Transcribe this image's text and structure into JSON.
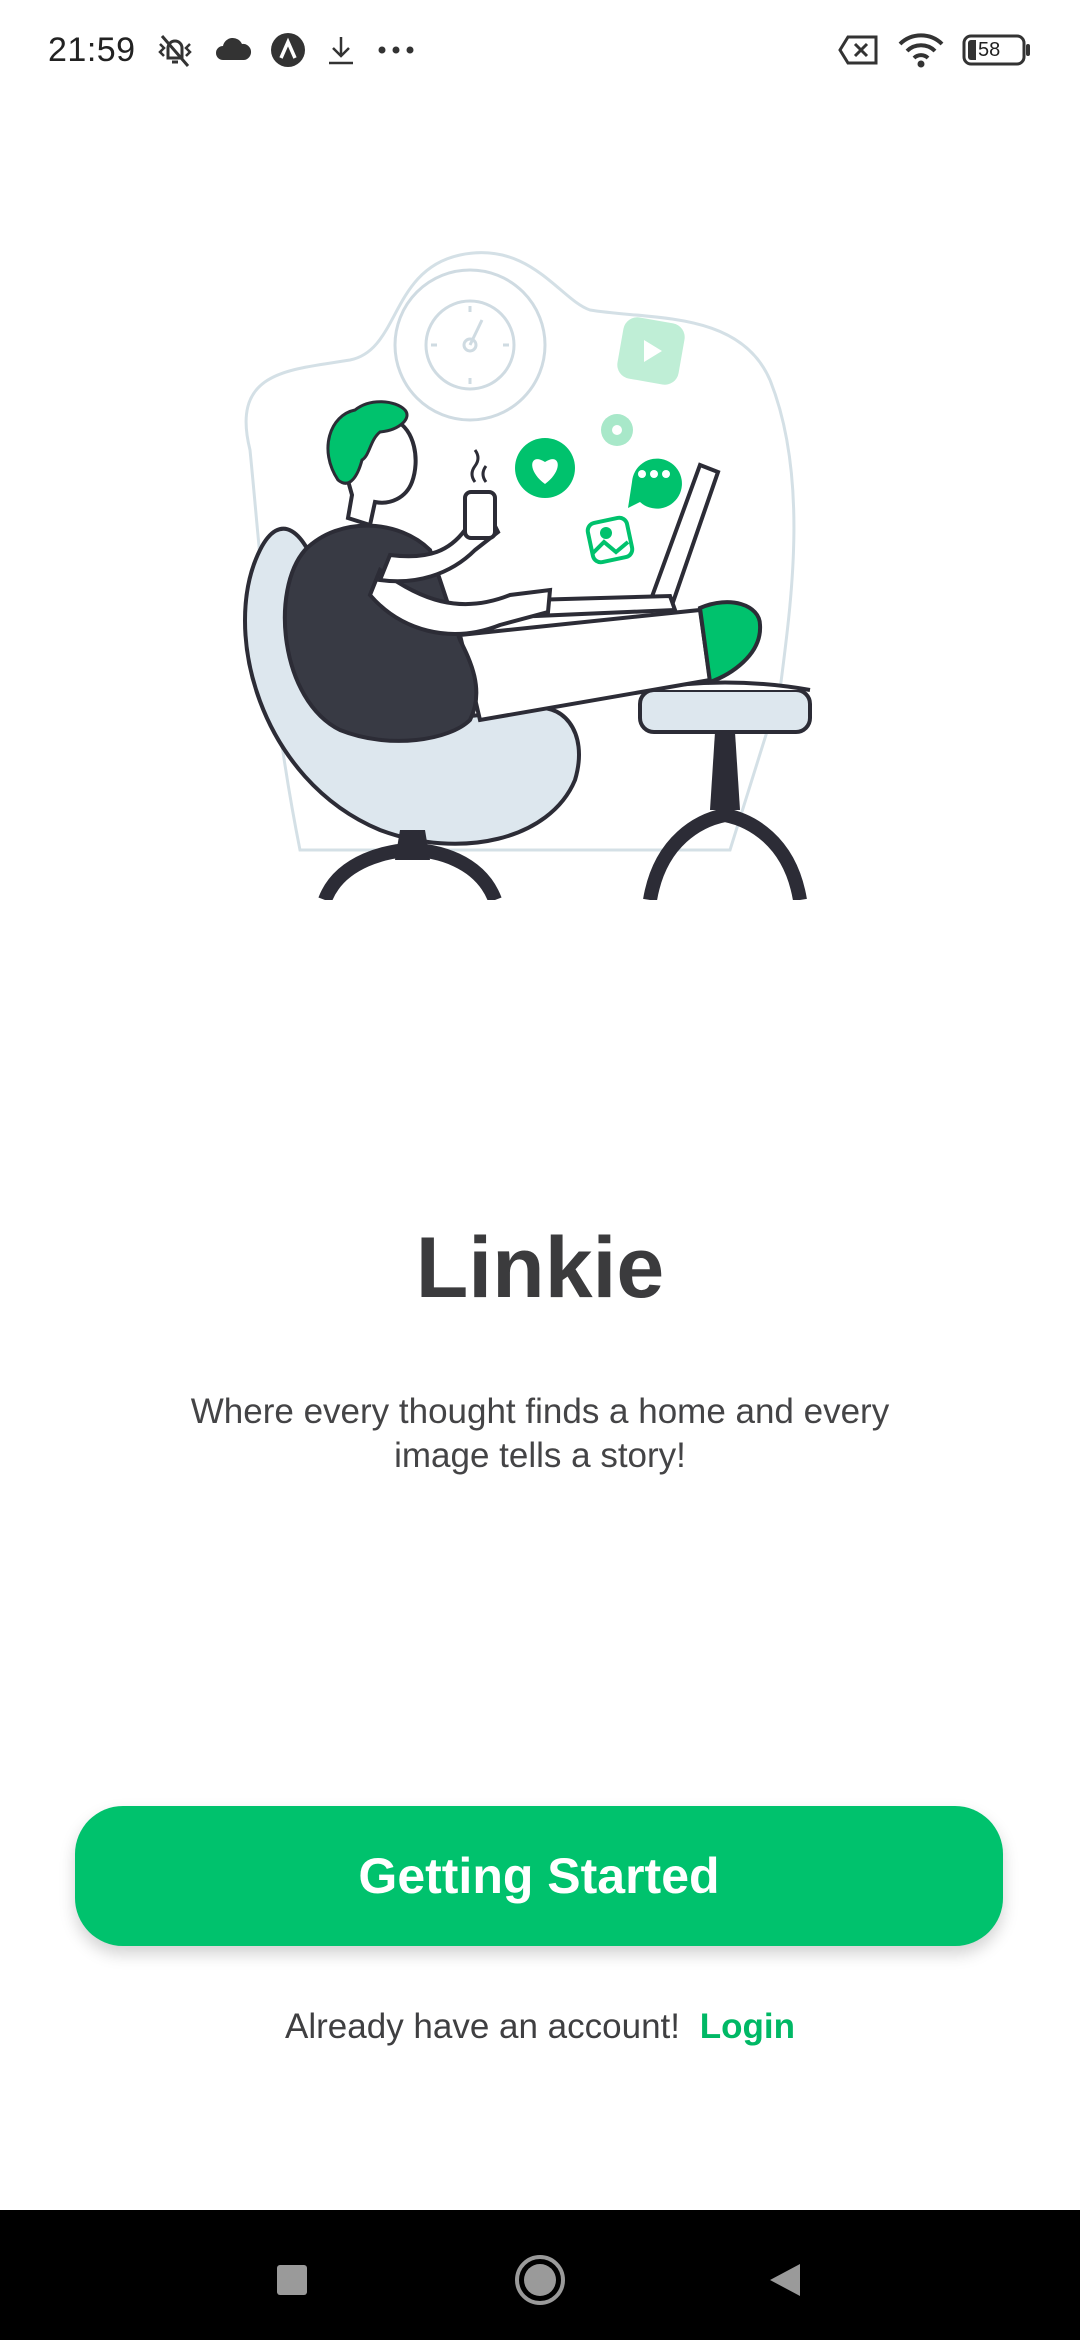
{
  "status_bar": {
    "time": "21:59",
    "battery": "58",
    "icons": [
      "vibrate-off-icon",
      "cloud-icon",
      "app-notification-icon",
      "download-icon",
      "more-dots-icon",
      "sim-off-icon",
      "wifi-icon",
      "battery-icon"
    ]
  },
  "onboarding": {
    "title": "Linkie",
    "tagline": "Where every thought finds a home and every image tells a story!",
    "primary_button": "Getting Started",
    "login_prompt": "Already have an account!",
    "login_link": "Login"
  },
  "nav_bar": {
    "icons": [
      "recent-apps-icon",
      "home-icon",
      "back-icon"
    ]
  },
  "colors": {
    "accent": "#00c26d",
    "text_dark": "#3b3b3d",
    "nav_background": "#000000"
  }
}
